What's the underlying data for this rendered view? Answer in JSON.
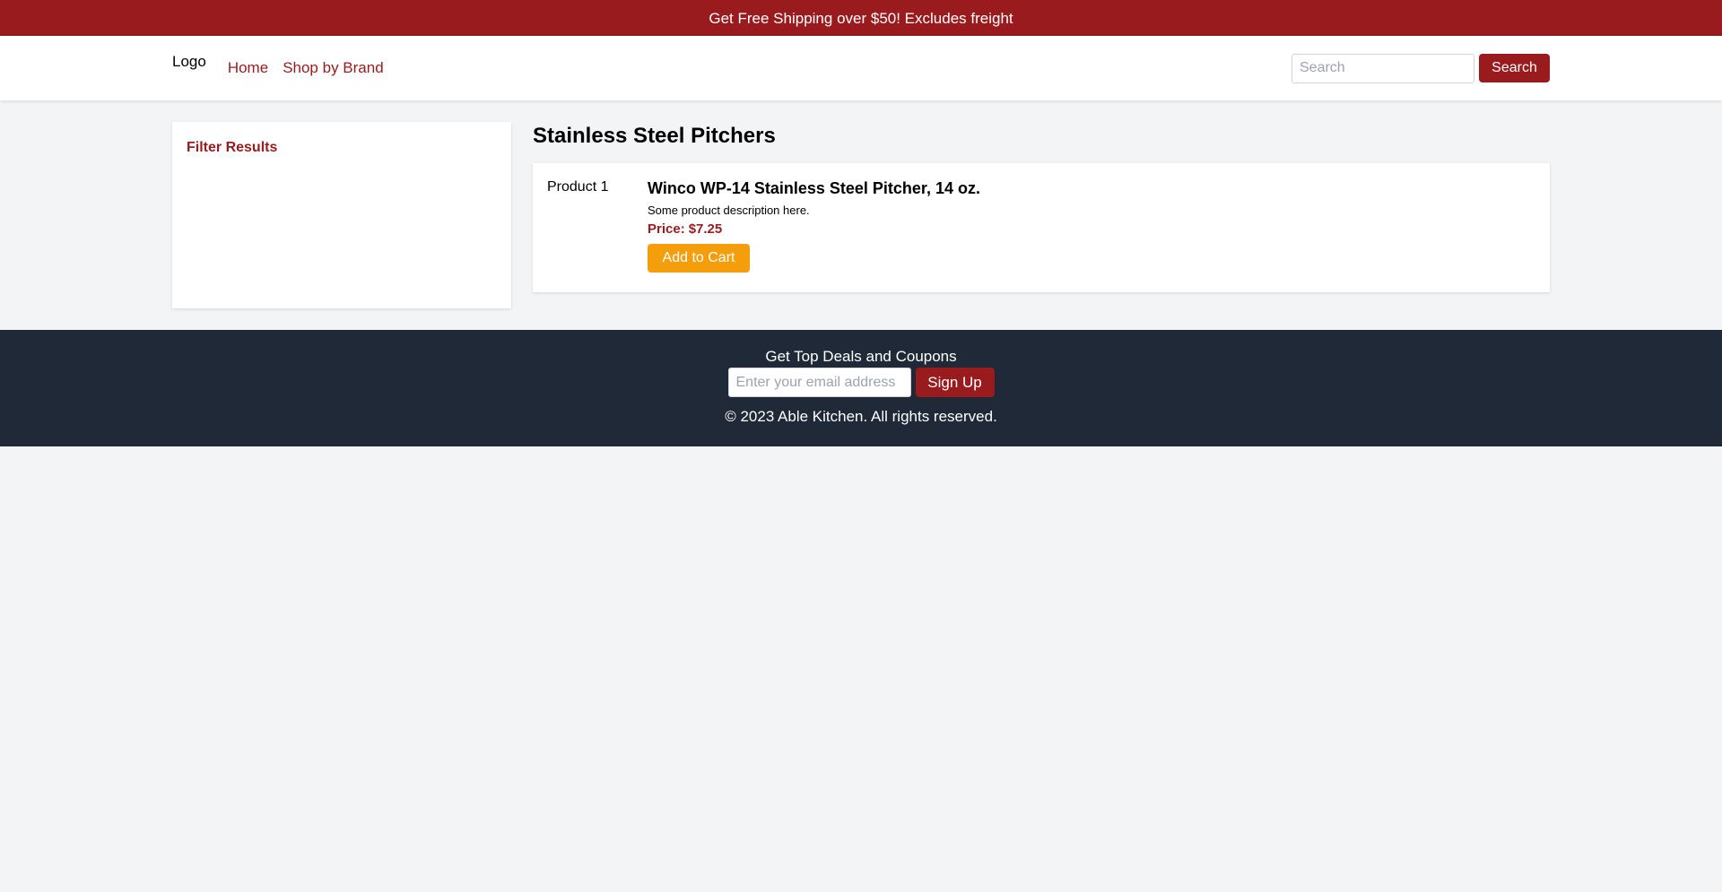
{
  "promo": {
    "text": "Get Free Shipping over $50! Excludes freight"
  },
  "header": {
    "logo": "Logo",
    "nav": [
      {
        "label": "Home"
      },
      {
        "label": "Shop by Brand"
      }
    ],
    "search_placeholder": "Search",
    "search_button": "Search"
  },
  "sidebar": {
    "title": "Filter Results"
  },
  "main": {
    "title": "Stainless Steel Pitchers",
    "products": [
      {
        "image_label": "Product 1",
        "name": "Winco WP-14 Stainless Steel Pitcher, 14 oz.",
        "description": "Some product description here.",
        "price_label": "Price:",
        "price": "$7.25",
        "button": "Add to Cart"
      }
    ]
  },
  "footer": {
    "heading": "Get Top Deals and Coupons",
    "email_placeholder": "Enter your email address",
    "signup_button": "Sign Up",
    "copyright": "© 2023 Able Kitchen. All rights reserved."
  },
  "colors": {
    "brand": "#991b1e",
    "accent": "#f59e0b",
    "footer_bg": "#1f2937",
    "page_bg": "#f3f4f6"
  }
}
